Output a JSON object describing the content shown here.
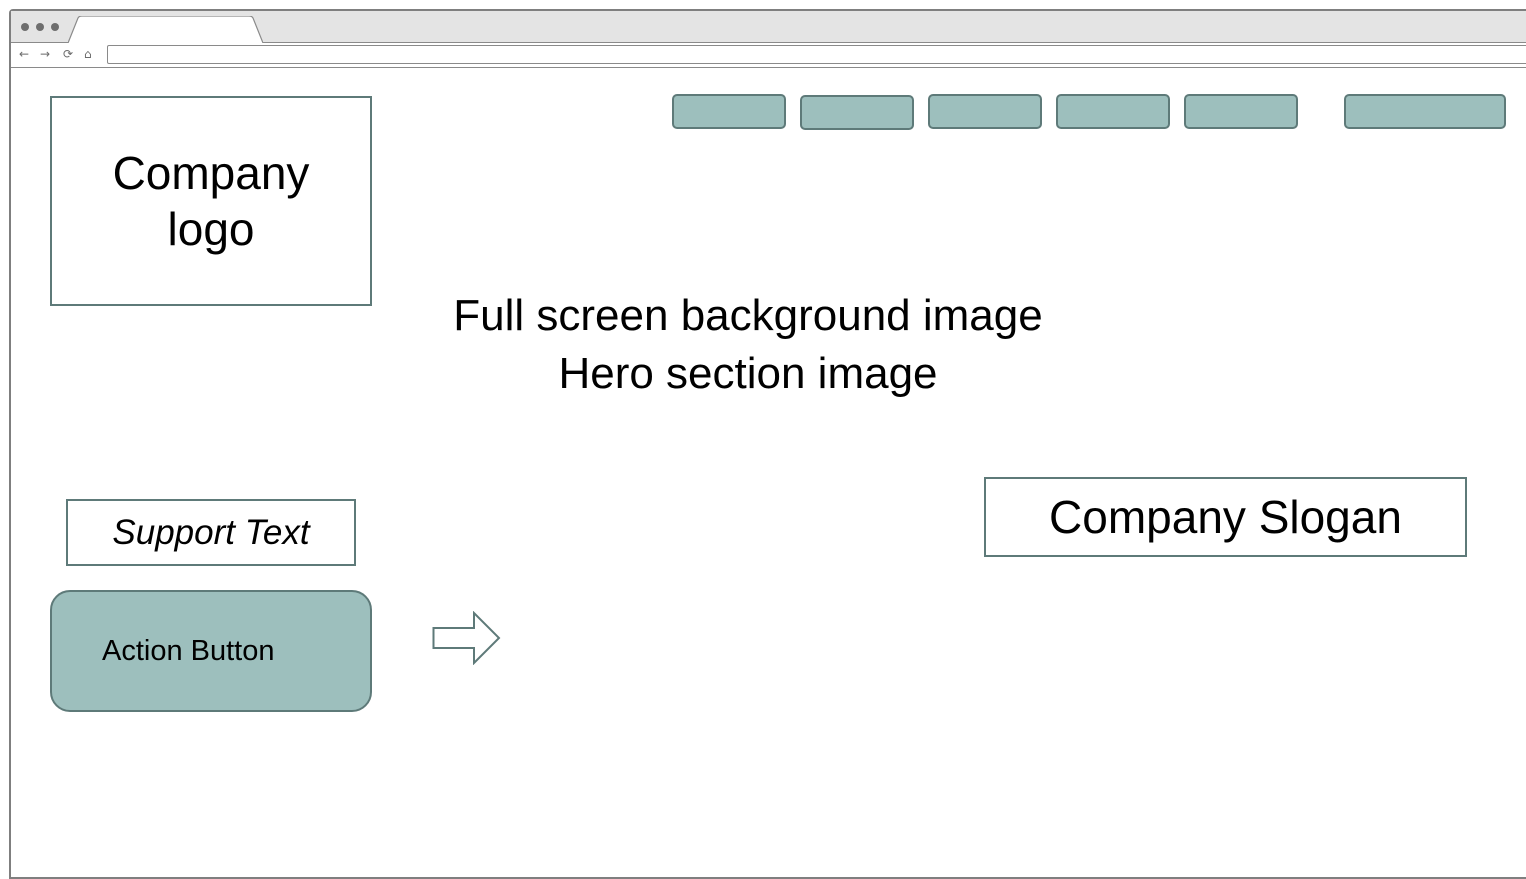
{
  "logo": {
    "label_line1": "Company",
    "label_line2": "logo"
  },
  "nav": {
    "button_count": 6
  },
  "hero": {
    "line1": "Full screen background image",
    "line2": "Hero section image"
  },
  "support": {
    "text": "Support Text"
  },
  "action": {
    "label": "Action Button"
  },
  "slogan": {
    "text": "Company Slogan"
  },
  "colors": {
    "button_fill": "#9dbfbd",
    "button_border": "#5e7a79",
    "chrome_bg": "#e4e4e4",
    "chrome_border": "#8a8a8a"
  },
  "icons": [
    "back-arrow-icon",
    "forward-arrow-icon",
    "reload-icon",
    "home-icon",
    "right-arrow-outline-icon"
  ]
}
